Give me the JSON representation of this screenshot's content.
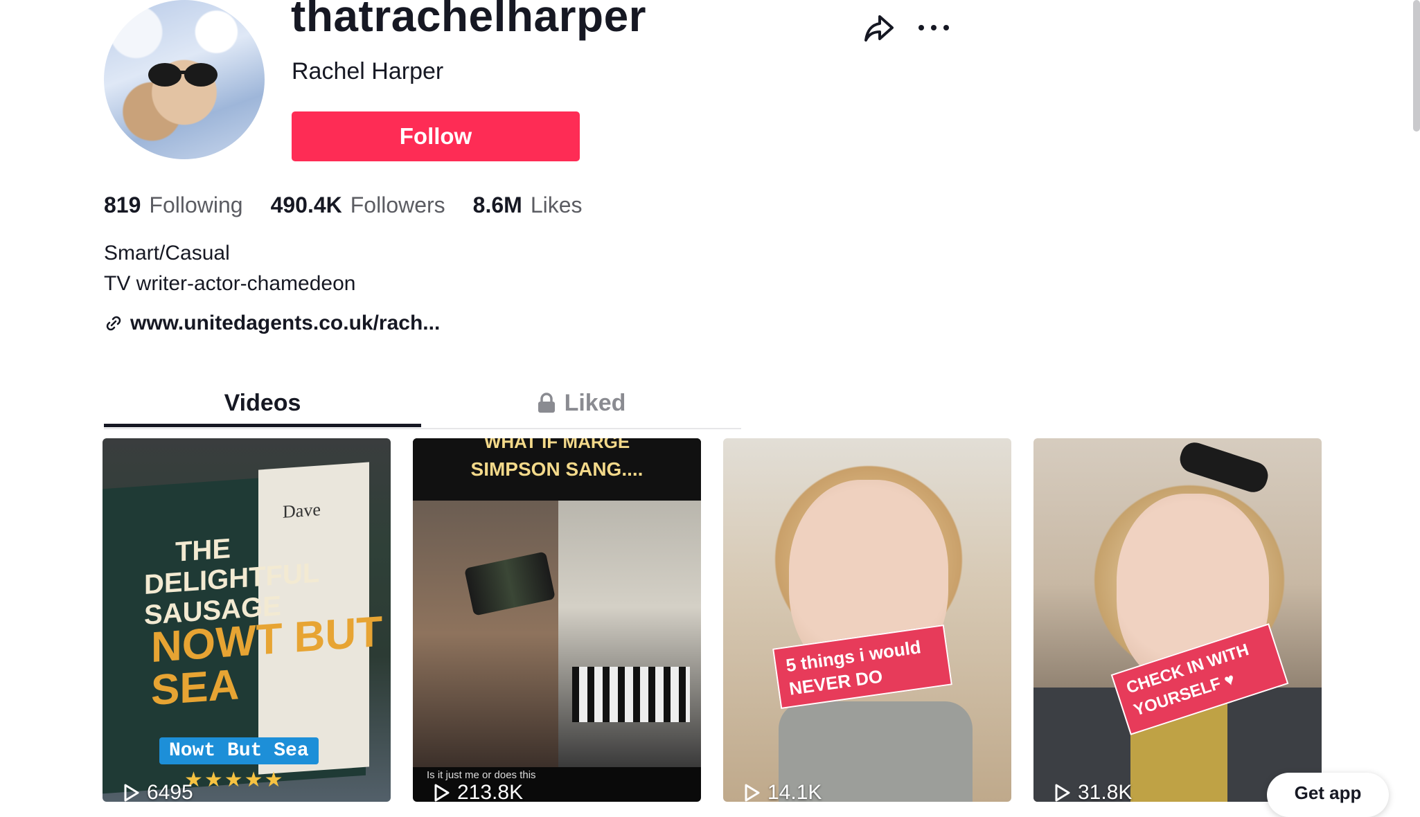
{
  "profile": {
    "username": "thatrachelharper",
    "display_name": "Rachel Harper",
    "follow_label": "Follow"
  },
  "stats": {
    "following_count": "819",
    "following_label": "Following",
    "followers_count": "490.4K",
    "followers_label": "Followers",
    "likes_count": "8.6M",
    "likes_label": "Likes"
  },
  "bio": {
    "line1": "Smart/Casual",
    "line2": "TV writer-actor-chamedeon",
    "link": "www.unitedagents.co.uk/rach..."
  },
  "tabs": [
    {
      "label": "Videos",
      "active": true
    },
    {
      "label": "Liked",
      "active": false,
      "icon": "lock-icon"
    }
  ],
  "videos": [
    {
      "views": "6495",
      "poster_title": "THE DELIGHTFUL SAUSAGE",
      "poster_sub": "NOWT BUT SEA",
      "poster_brand": "Dave",
      "caption": "Nowt But Sea",
      "stars": "★★★★★"
    },
    {
      "views": "213.8K",
      "headline_line1": "WHAT IF MARGE",
      "headline_line2": "SIMPSON SANG....",
      "caption": "Is it just me or does this"
    },
    {
      "views": "14.1K",
      "sticker": "5 things i would NEVER DO"
    },
    {
      "views": "31.8K",
      "sticker": "CHECK IN WITH YOURSELF ♥"
    }
  ],
  "get_app_label": "Get app",
  "colors": {
    "accent": "#fe2c55",
    "text_primary": "#161823",
    "text_secondary": "#5b5c62"
  }
}
